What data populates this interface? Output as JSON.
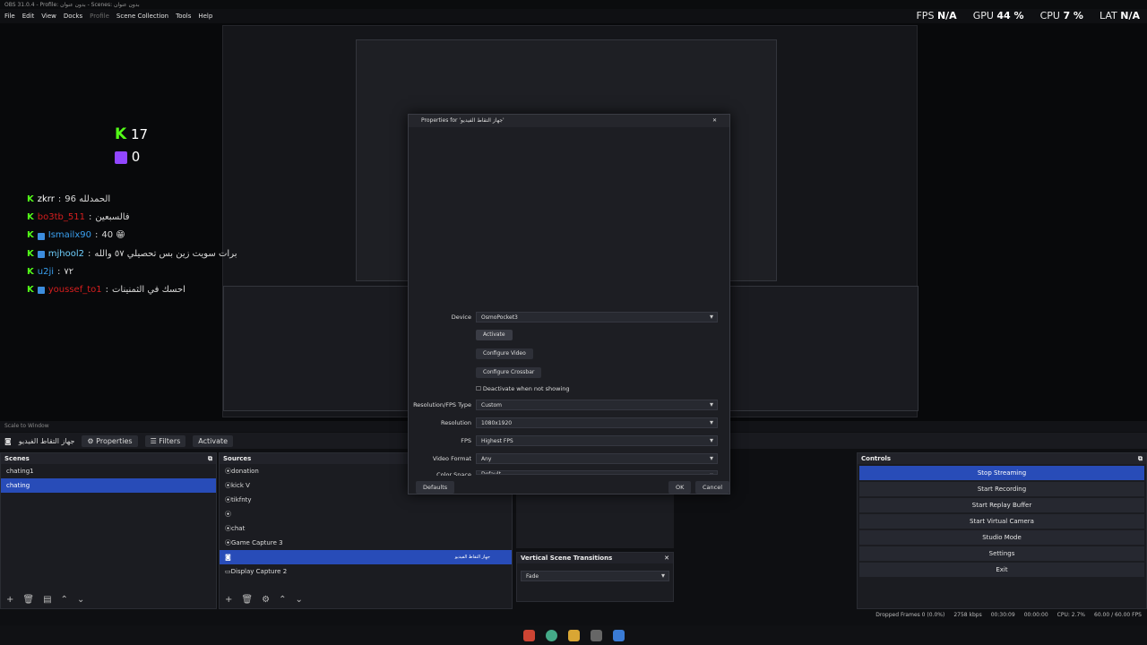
{
  "window": {
    "title": "OBS 31.0.4 - Profile: بدون عنوان - Scenes: بدون عنوان"
  },
  "menu": [
    "File",
    "Edit",
    "View",
    "Docks",
    "Profile",
    "Scene Collection",
    "Tools",
    "Help"
  ],
  "stats": {
    "fps_label": "FPS",
    "fps": "N/A",
    "gpu_label": "GPU",
    "gpu": "44 %",
    "cpu_label": "CPU",
    "cpu": "7 %",
    "lat_label": "LAT",
    "lat": "N/A"
  },
  "overlay": {
    "kick_count": "17",
    "twitch_count": "0",
    "chat": [
      {
        "user": "zkrr",
        "msg": "96 الحمدلله",
        "color": "#ffffff"
      },
      {
        "user": "bo3tb_511",
        "msg": "فالسبعين",
        "color": "#d61e1e"
      },
      {
        "user": "Ismailx90",
        "msg": "40 😁",
        "color": "#3aa0f0"
      },
      {
        "user": "mjhool2",
        "msg": "برات سويت زين بس تحصيلي ٥٧ والله",
        "color": "#6fd0ff"
      },
      {
        "user": "u2ji",
        "msg": "٧٢",
        "color": "#3aa0f0"
      },
      {
        "user": "youssef_to1",
        "msg": "احسك في الثمنينات",
        "color": "#d61e1e"
      }
    ]
  },
  "scale_label": "Scale to Window",
  "source_bar": {
    "selected": "جهاز التقاط الفيديو",
    "properties": "Properties",
    "filters": "Filters",
    "activate": "Activate"
  },
  "scenes": {
    "title": "Scenes",
    "items": [
      "chating1",
      "chating"
    ],
    "selected": 1
  },
  "sources": {
    "title": "Sources",
    "items": [
      "donation",
      "kick V",
      "tikfnty",
      "",
      "chat",
      "Game Capture 3",
      "",
      "Display Capture 2"
    ],
    "selected": 6,
    "selected_name": "جهاز التقاط الفيديو"
  },
  "controls": {
    "title": "Controls",
    "buttons": [
      "Stop Streaming",
      "Start Recording",
      "Start Replay Buffer",
      "Start Virtual Camera",
      "Studio Mode",
      "Settings",
      "Exit"
    ]
  },
  "vertical_transitions": {
    "title": "Vertical Scene Transitions",
    "value": "Fade"
  },
  "dialog": {
    "title": "Properties for 'جهاز التقاط الفيديو'",
    "device_label": "Device",
    "device": "OsmoPocket3",
    "activate": "Activate",
    "configure_video": "Configure Video",
    "configure_crossbar": "Configure Crossbar",
    "deactivate_label": "Deactivate when not showing",
    "res_type_label": "Resolution/FPS Type",
    "res_type": "Custom",
    "resolution_label": "Resolution",
    "resolution": "1080x1920",
    "fps_label": "FPS",
    "fps": "Highest FPS",
    "video_format_label": "Video Format",
    "video_format": "Any",
    "color_space_label": "Color Space",
    "color_space": "Default",
    "defaults": "Defaults",
    "ok": "OK",
    "cancel": "Cancel"
  },
  "status": {
    "dropped": "Dropped Frames 0 (0.0%)",
    "kbps": "2758 kbps",
    "live": "00:30:09",
    "rec": "00:00:00",
    "cpu": "CPU: 2.7%",
    "fps": "60.00 / 60.00 FPS"
  }
}
